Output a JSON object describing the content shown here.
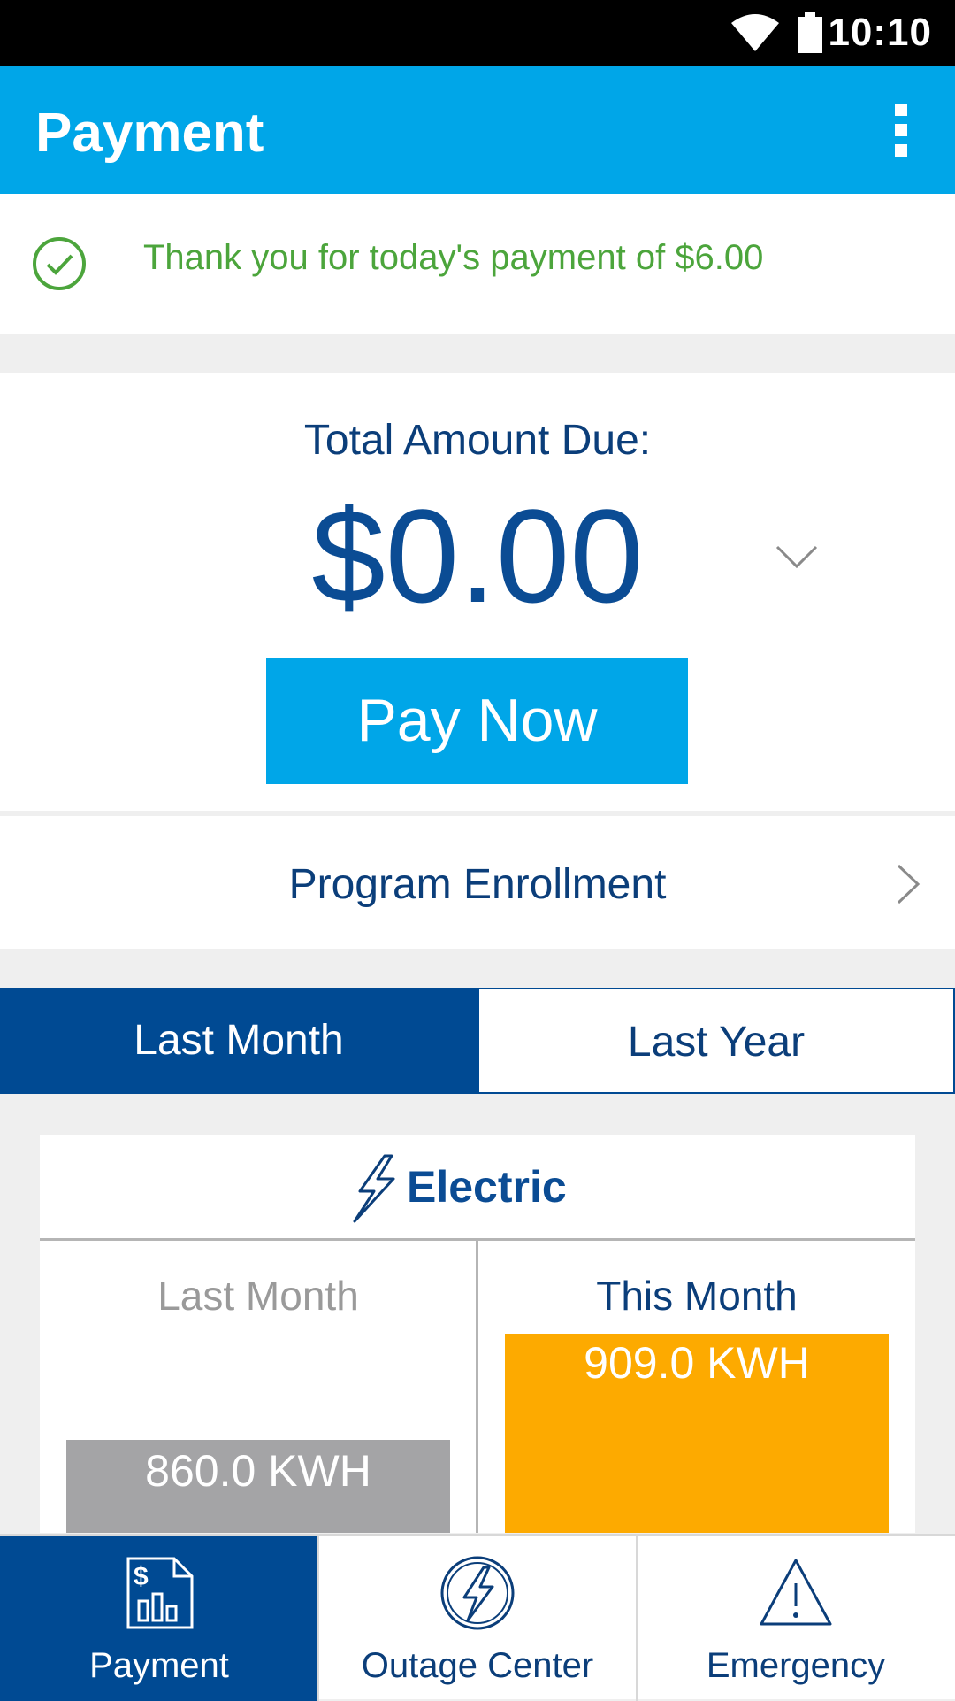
{
  "status_bar": {
    "time": "10:10"
  },
  "app_bar": {
    "title": "Payment"
  },
  "notice": {
    "message": "Thank you for today's payment of $6.00"
  },
  "due": {
    "label": "Total Amount Due:",
    "amount": "$0.00",
    "pay_button": "Pay Now"
  },
  "enrollment": {
    "label": "Program Enrollment"
  },
  "tabs": {
    "active": "Last Month",
    "inactive": "Last Year"
  },
  "usage": {
    "title": "Electric",
    "last_month": {
      "label": "Last Month",
      "value": "860.0 KWH"
    },
    "this_month": {
      "label": "This Month",
      "value": "909.0 KWH"
    }
  },
  "colors": {
    "brand_blue": "#00a6e8",
    "navy": "#004a93",
    "success_green": "#4ca53c",
    "last_bar": "#a4a4a6",
    "this_bar": "#fdaa00"
  },
  "bottom_nav": [
    {
      "label": "Payment",
      "icon": "bill-chart-icon"
    },
    {
      "label": "Outage Center",
      "icon": "lightning-circle-icon"
    },
    {
      "label": "Emergency",
      "icon": "warning-triangle-icon"
    }
  ]
}
